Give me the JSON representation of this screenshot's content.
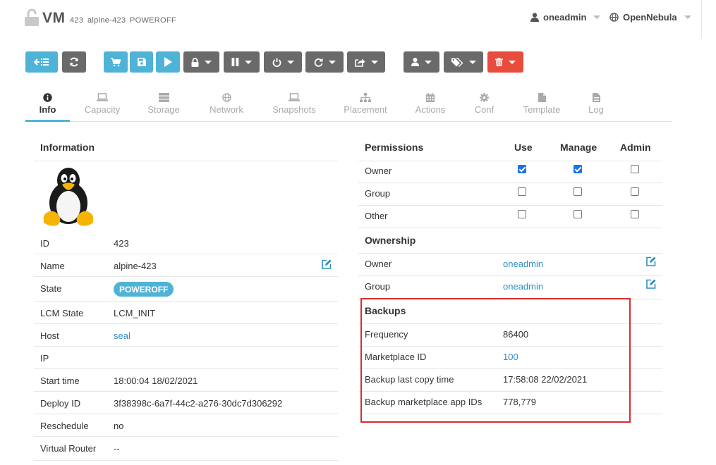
{
  "header": {
    "title": "VM",
    "vm_id": "423",
    "vm_name": "alpine-423",
    "vm_state": "POWEROFF",
    "user": "oneadmin",
    "zone": "OpenNebula"
  },
  "tabs": [
    "Info",
    "Capacity",
    "Storage",
    "Network",
    "Snapshots",
    "Placement",
    "Actions",
    "Conf",
    "Template",
    "Log"
  ],
  "information": {
    "title": "Information",
    "rows": [
      {
        "label": "ID",
        "value": "423"
      },
      {
        "label": "Name",
        "value": "alpine-423"
      },
      {
        "label": "State",
        "value": "POWEROFF"
      },
      {
        "label": "LCM State",
        "value": "LCM_INIT"
      },
      {
        "label": "Host",
        "value": "seal"
      },
      {
        "label": "IP",
        "value": ""
      },
      {
        "label": "Start time",
        "value": "18:00:04 18/02/2021"
      },
      {
        "label": "Deploy ID",
        "value": "3f38398c-6a7f-44c2-a276-30dc7d306292"
      },
      {
        "label": "Reschedule",
        "value": "no"
      },
      {
        "label": "Virtual Router",
        "value": "--"
      }
    ]
  },
  "permissions": {
    "title": "Permissions",
    "columns": [
      "Use",
      "Manage",
      "Admin"
    ],
    "rows": [
      {
        "label": "Owner",
        "use": true,
        "manage": true,
        "admin": false
      },
      {
        "label": "Group",
        "use": false,
        "manage": false,
        "admin": false
      },
      {
        "label": "Other",
        "use": false,
        "manage": false,
        "admin": false
      }
    ]
  },
  "ownership": {
    "title": "Ownership",
    "rows": [
      {
        "label": "Owner",
        "value": "oneadmin"
      },
      {
        "label": "Group",
        "value": "oneadmin"
      }
    ]
  },
  "backups": {
    "title": "Backups",
    "rows": [
      {
        "label": "Frequency",
        "value": "86400"
      },
      {
        "label": "Marketplace ID",
        "value": "100"
      },
      {
        "label": "Backup last copy time",
        "value": "17:58:08 22/02/2021"
      },
      {
        "label": "Backup marketplace app IDs",
        "value": "778,779"
      }
    ]
  },
  "colors": {
    "accent": "#4fb3d7",
    "button_grey": "#6a6a6a",
    "button_red": "#e74c3c",
    "link": "#2d8fbf",
    "highlight_box": "#d32f2f"
  },
  "toolbar_icons": [
    "back-list-icon",
    "refresh-icon",
    "cart-icon",
    "save-icon",
    "play-icon",
    "lock-icon",
    "pause-icon",
    "power-icon",
    "reboot-icon",
    "share-icon",
    "user-icon",
    "tags-icon",
    "trash-icon"
  ]
}
